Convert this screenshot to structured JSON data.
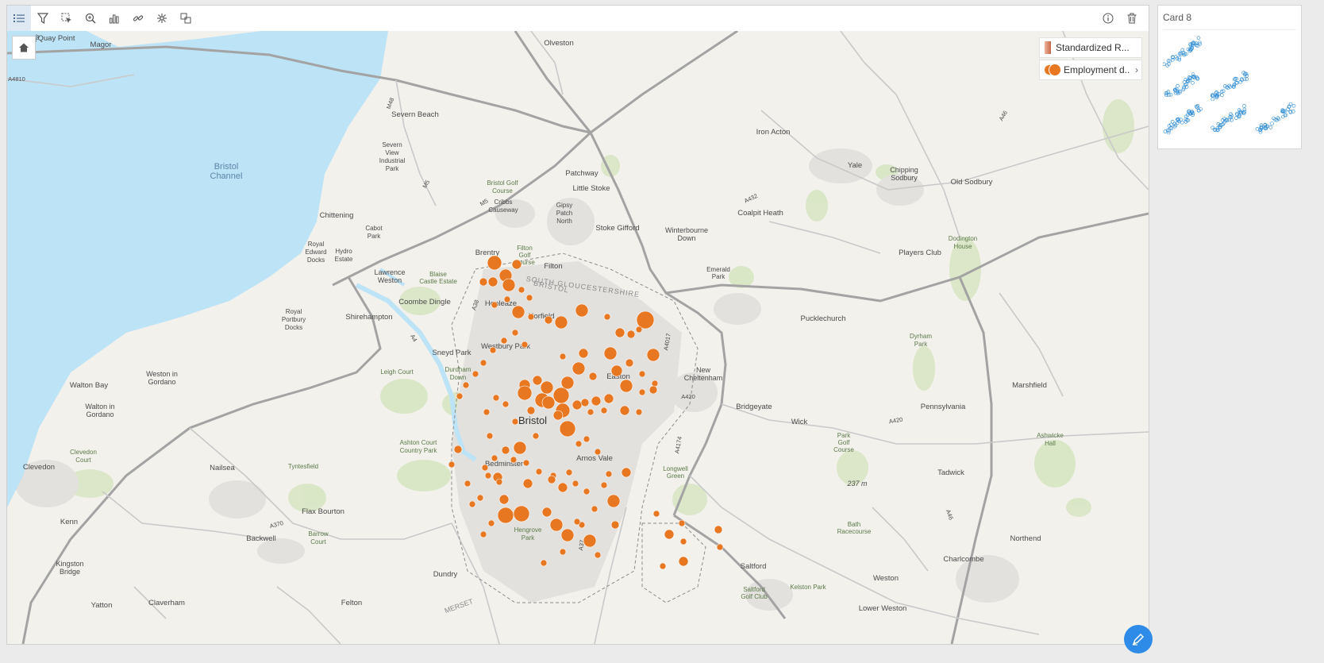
{
  "map_card": {
    "toolbar": {
      "left_buttons": [
        {
          "name": "legend-list-button",
          "icon": "list-icon"
        },
        {
          "name": "filter-button",
          "icon": "filter-icon"
        },
        {
          "name": "select-button",
          "icon": "select-icon"
        },
        {
          "name": "zoom-button",
          "icon": "zoom-icon"
        },
        {
          "name": "chart-button",
          "icon": "bar-chart-icon"
        },
        {
          "name": "link-button",
          "icon": "link-icon"
        },
        {
          "name": "cluster-button",
          "icon": "cluster-icon"
        },
        {
          "name": "flip-card-button",
          "icon": "flip-icon"
        }
      ],
      "right_buttons": [
        {
          "name": "info-button",
          "icon": "info-icon"
        },
        {
          "name": "delete-button",
          "icon": "trash-icon"
        }
      ]
    },
    "legend": [
      {
        "label": "Standardized R...",
        "swatch": "#c8674a"
      },
      {
        "label": "Employment d...",
        "swatch": "#e87722"
      }
    ],
    "point_color": "#e87722",
    "place_labels": {
      "quay_point": "Quay Point",
      "magor": "Magor",
      "olveston": "Olveston",
      "severn_beach": "Severn Beach",
      "iron_acton": "Iron Acton",
      "bristol_channel_1": "Bristol",
      "bristol_channel_2": "Channel",
      "severn_view_1": "Severn",
      "severn_view_2": "View",
      "severn_view_3": "Industrial",
      "severn_view_4": "Park",
      "patchway": "Patchway",
      "yale": "Yale",
      "chipping_sodbury_1": "Chipping",
      "chipping_sodbury_2": "Sodbury",
      "old_sodbury": "Old Sodbury",
      "bristol_golf_1": "Bristol Golf",
      "bristol_golf_2": "Course",
      "little_stoke": "Little Stoke",
      "gipsy_1": "Gipsy",
      "gipsy_2": "Patch",
      "gipsy_3": "North",
      "cribbs_1": "Cribbs",
      "cribbs_2": "Causeway",
      "chittening": "Chittening",
      "coalpit_heath": "Coalpit Heath",
      "cabot_1": "Cabot",
      "cabot_2": "Park",
      "stoke_gifford": "Stoke Gifford",
      "winterbourne_1": "Winterbourne",
      "winterbourne_2": "Down",
      "dodington_1": "Dodington",
      "dodington_2": "House",
      "royal_edward_1": "Royal",
      "royal_edward_2": "Edward",
      "royal_edward_3": "Docks",
      "hydro_1": "Hydro",
      "hydro_2": "Estate",
      "brentry": "Brentry",
      "filton_golf_1": "Filton",
      "filton_golf_2": "Golf",
      "filton_golf_3": "Course",
      "players_club": "Players Club",
      "filton": "Filton",
      "lawrence_1": "Lawrence",
      "lawrence_2": "Weston",
      "blaise_1": "Blaise",
      "blaise_2": "Castle Estate",
      "south_glos": "SOUTH GLOUCESTERSHIRE",
      "bristol_label": "BRISTOL",
      "emerald_1": "Emerald",
      "emerald_2": "Park",
      "coombe_dingle": "Coombe Dingle",
      "henleaze": "Henleaze",
      "horfield": "Horfield",
      "royal_portbury_1": "Royal",
      "royal_portbury_2": "Portbury",
      "royal_portbury_3": "Docks",
      "shirehampton": "Shirehampton",
      "pucklechurch": "Pucklechurch",
      "dyrham_1": "Dyrham",
      "dyrham_2": "Park",
      "sneyd_park": "Sneyd Park",
      "westbury": "Westbury Park",
      "weston_gordano_1": "Weston in",
      "weston_gordano_2": "Gordano",
      "walton_bay": "Walton Bay",
      "leigh_court": "Leigh Court",
      "durdham_1": "Durdham",
      "durdham_2": "Down",
      "easton": "Easton",
      "new_chelt_1": "New",
      "new_chelt_2": "Cheltenham",
      "marshfield": "Marshfield",
      "walton_gordano_1": "Walton in",
      "walton_gordano_2": "Gordano",
      "bristol_city": "Bristol",
      "bridgeyate": "Bridgeyate",
      "pennsylvania": "Pennsylvania",
      "wick": "Wick",
      "ashwicke_1": "Ashwicke",
      "ashwicke_2": "Hall",
      "ashton_court_1": "Ashton Court",
      "ashton_court_2": "Country Park",
      "park_golf_1": "Park",
      "park_golf_2": "Golf",
      "park_golf_3": "Course",
      "clevedon_court_1": "Clevedon",
      "clevedon_court_2": "Court",
      "clevedon": "Clevedon",
      "tyntesfield": "Tyntesfield",
      "nailsea": "Nailsea",
      "bedminster": "Bedminster",
      "arnos_vale": "Arnos Vale",
      "longwell_1": "Longwell",
      "longwell_2": "Green",
      "tadwick": "Tadwick",
      "elevation": "237 m",
      "flax_bourton": "Flax Bourton",
      "kenn": "Kenn",
      "backwell": "Backwell",
      "barrow_court_1": "Barrow",
      "barrow_court_2": "Court",
      "hengrove_1": "Hengrove",
      "hengrove_2": "Park",
      "bath_race_1": "Bath",
      "bath_race_2": "Racecourse",
      "northend": "Northend",
      "kingston_1": "Kingston",
      "kingston_2": "Bridge",
      "charlcombe": "Charlcombe",
      "saltford": "Saltford",
      "saltford_golf_1": "Saltford",
      "saltford_golf_2": "Golf Club",
      "kelston": "Kelston Park",
      "weston": "Weston",
      "dundry": "Dundry",
      "yatton": "Yatton",
      "claverham": "Claverham",
      "felton": "Felton",
      "lower_weston": "Lower Weston",
      "somerset": "MERSET",
      "road_m5": "M5",
      "road_m48": "M48",
      "road_a4": "A4",
      "road_a420_1": "A420",
      "road_a420_2": "A420",
      "road_a432": "A432",
      "road_a4017": "A4017",
      "road_a4174": "A4174",
      "road_a37": "A37",
      "road_a46_1": "A46",
      "road_a46_2": "A46",
      "road_a370": "A370",
      "road_a4810": "A4810",
      "road_a48": "A48",
      "road_a38": "A38"
    }
  },
  "side_card": {
    "title": "Card 8",
    "thumbnail_color": "#2a8ad4",
    "thumbnails": [
      "scatter-thumb-1",
      "scatter-thumb-2",
      "scatter-thumb-3",
      "scatter-thumb-4",
      "scatter-thumb-5",
      "scatter-thumb-6"
    ]
  }
}
